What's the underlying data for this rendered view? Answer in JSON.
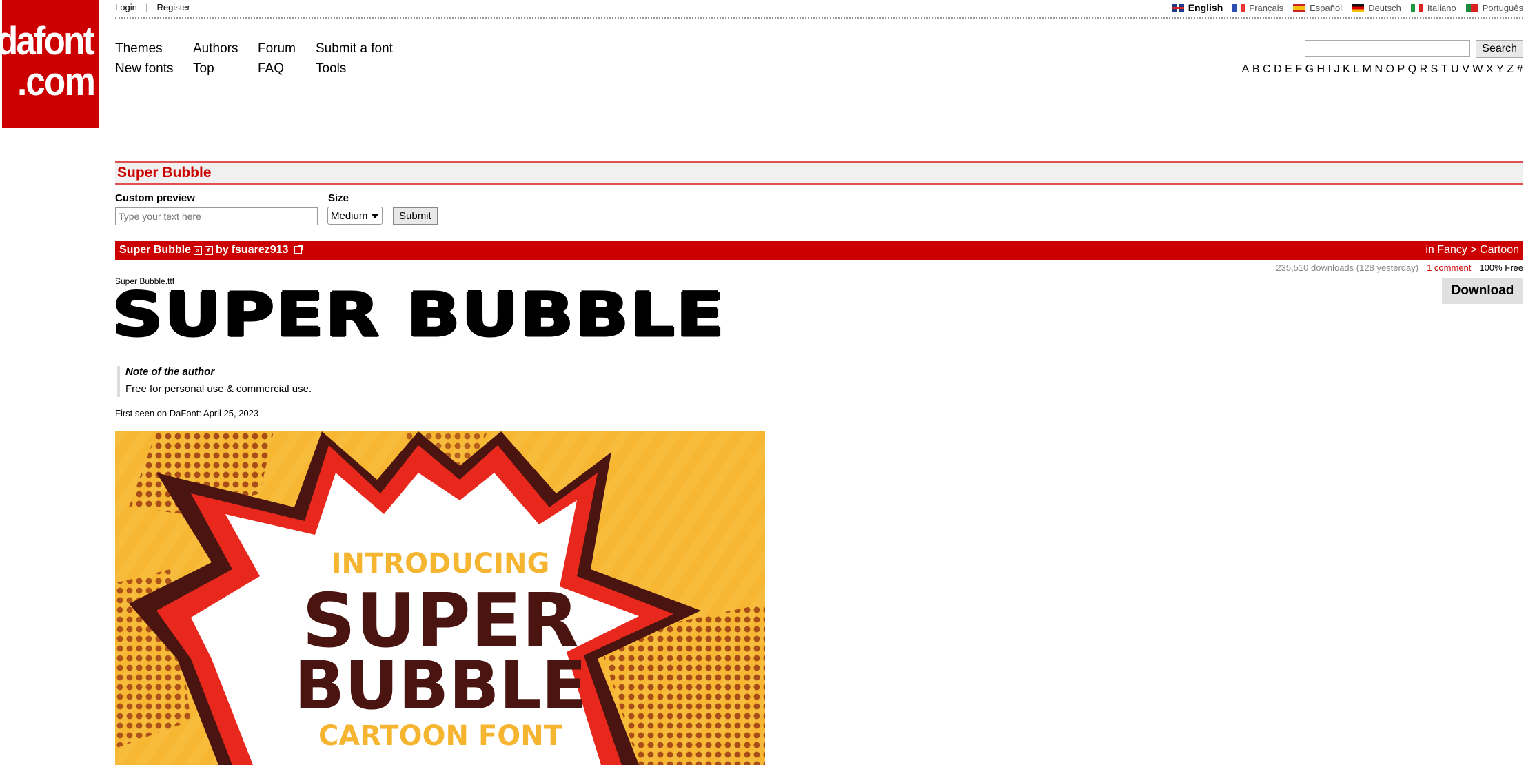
{
  "logo": {
    "line1": "dafont",
    "line2": ".com"
  },
  "auth": {
    "login": "Login",
    "sep": "|",
    "register": "Register"
  },
  "languages": [
    {
      "label": "English",
      "flag": "flag-en"
    },
    {
      "label": "Français",
      "flag": "flag-fr"
    },
    {
      "label": "Español",
      "flag": "flag-es"
    },
    {
      "label": "Deutsch",
      "flag": "flag-de"
    },
    {
      "label": "Italiano",
      "flag": "flag-it"
    },
    {
      "label": "Português",
      "flag": "flag-pt"
    }
  ],
  "nav": {
    "themes": "Themes",
    "authors": "Authors",
    "forum": "Forum",
    "submit": "Submit a font",
    "new_fonts": "New fonts",
    "top": "Top",
    "faq": "FAQ",
    "tools": "Tools"
  },
  "search": {
    "value": "",
    "button": "Search"
  },
  "alphabet": [
    "A",
    "B",
    "C",
    "D",
    "E",
    "F",
    "G",
    "H",
    "I",
    "J",
    "K",
    "L",
    "M",
    "N",
    "O",
    "P",
    "Q",
    "R",
    "S",
    "T",
    "U",
    "V",
    "W",
    "X",
    "Y",
    "Z",
    "#"
  ],
  "page_title": "Super Bubble",
  "custom_preview": {
    "label": "Custom preview",
    "placeholder": "Type your text here"
  },
  "size": {
    "label": "Size",
    "selected": "Medium"
  },
  "submit_label": "Submit",
  "font": {
    "name": "Super Bubble",
    "by": "by",
    "author": "fsuarez913",
    "category": "in Fancy > Cartoon",
    "downloads": "235,510 downloads (128 yesterday)",
    "comments": "1 comment",
    "license": "100% Free",
    "download_label": "Download",
    "filename": "Super Bubble.ttf",
    "preview": "SUPER BUBBLE",
    "note_title": "Note of the author",
    "note_body": "Free for personal use & commercial use.",
    "first_seen": "First seen on DaFont: April 25, 2023"
  },
  "artwork": {
    "line1": "INTRODUCING",
    "line2": "SUPER",
    "line3": "BUBBLE",
    "line4": "CARTOON FONT",
    "colors": {
      "bg": "#f7b733",
      "red": "#e8281d",
      "dark": "#4a1410",
      "white": "#ffffff",
      "gold": "#f5b531"
    }
  }
}
